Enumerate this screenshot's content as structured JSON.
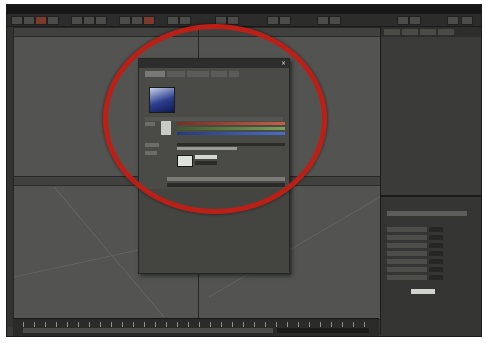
{
  "window": {
    "title": ""
  },
  "viewports": [
    {
      "label": ""
    },
    {
      "label": ""
    },
    {
      "label": ""
    },
    {
      "label": ""
    }
  ],
  "dialog": {
    "title": ""
  },
  "right_panel": {
    "lower_title": ""
  },
  "colors": {
    "app_background": "#3a3b38",
    "viewport": "#535451",
    "annotation_circle": "#bb1f16",
    "swatch_blue": "#2c3e8e",
    "slider_red": "#c46046",
    "slider_green": "#7aa257",
    "slider_blue": "#4b6ec4"
  },
  "icons": [
    "close-icon",
    "material-swatch-icon",
    "texture-thumbnail-icon"
  ]
}
